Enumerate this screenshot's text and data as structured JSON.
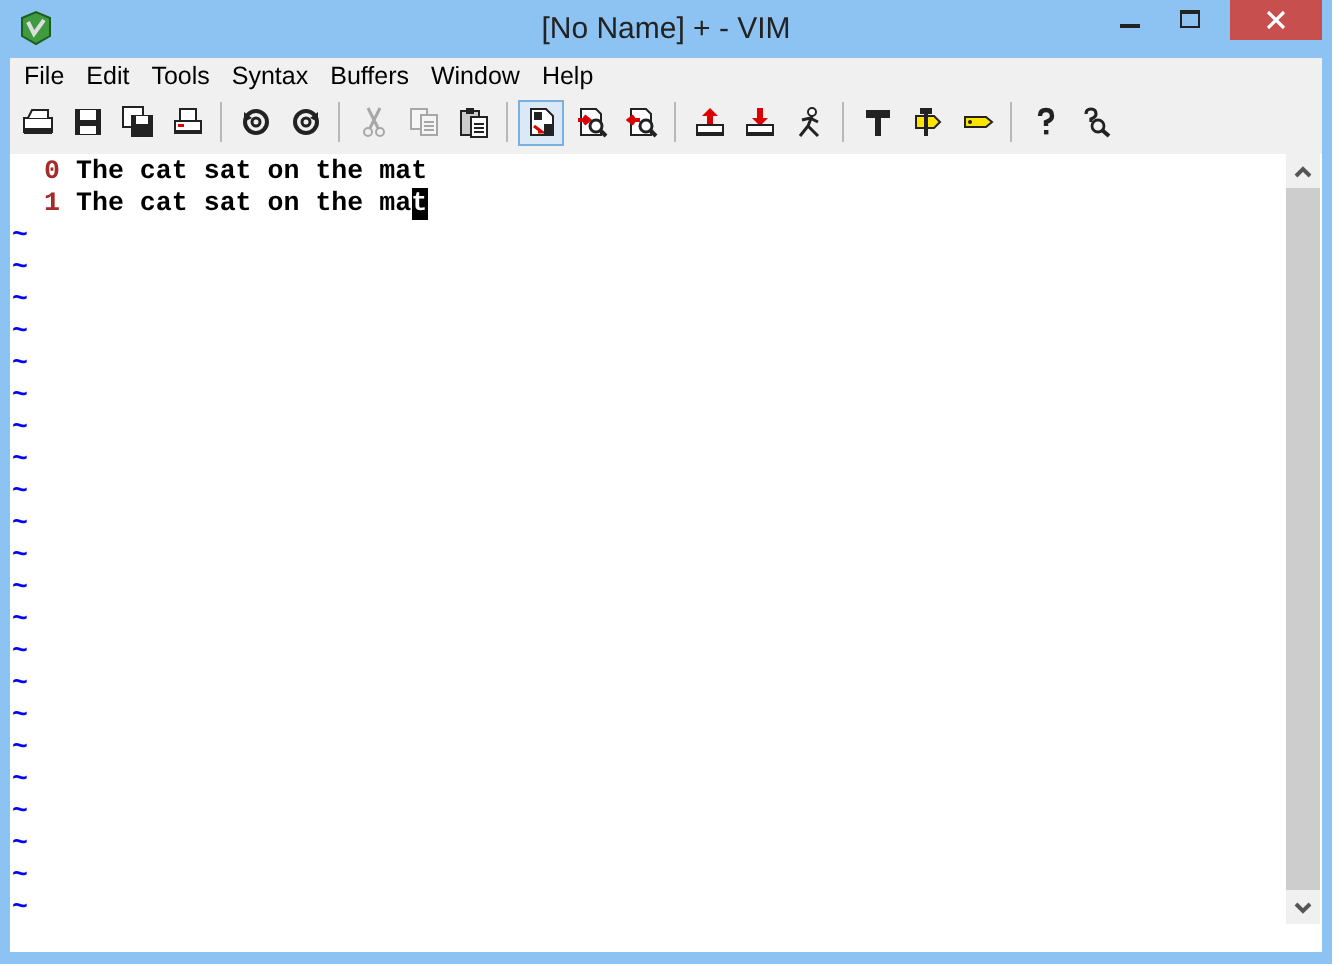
{
  "window": {
    "title": "[No Name] + - VIM"
  },
  "menu": [
    "File",
    "Edit",
    "Tools",
    "Syntax",
    "Buffers",
    "Window",
    "Help"
  ],
  "toolbar": [
    {
      "kind": "open",
      "disabled": false,
      "pressed": false
    },
    {
      "kind": "save",
      "disabled": false,
      "pressed": false
    },
    {
      "kind": "saveall",
      "disabled": false,
      "pressed": false
    },
    {
      "kind": "print",
      "disabled": false,
      "pressed": false
    },
    {
      "kind": "separator"
    },
    {
      "kind": "undo",
      "disabled": false,
      "pressed": false
    },
    {
      "kind": "redo",
      "disabled": false,
      "pressed": false
    },
    {
      "kind": "separator"
    },
    {
      "kind": "cut",
      "disabled": true,
      "pressed": false
    },
    {
      "kind": "copy",
      "disabled": true,
      "pressed": false
    },
    {
      "kind": "paste",
      "disabled": false,
      "pressed": false
    },
    {
      "kind": "separator"
    },
    {
      "kind": "replace",
      "disabled": false,
      "pressed": true
    },
    {
      "kind": "findnext",
      "disabled": false,
      "pressed": false
    },
    {
      "kind": "findprev",
      "disabled": false,
      "pressed": false
    },
    {
      "kind": "separator"
    },
    {
      "kind": "loadsession",
      "disabled": false,
      "pressed": false
    },
    {
      "kind": "savesession",
      "disabled": false,
      "pressed": false
    },
    {
      "kind": "runscript",
      "disabled": false,
      "pressed": false
    },
    {
      "kind": "separator"
    },
    {
      "kind": "make",
      "disabled": false,
      "pressed": false
    },
    {
      "kind": "tags",
      "disabled": false,
      "pressed": false
    },
    {
      "kind": "tagjump",
      "disabled": false,
      "pressed": false
    },
    {
      "kind": "separator"
    },
    {
      "kind": "help",
      "disabled": false,
      "pressed": false
    },
    {
      "kind": "findhelp",
      "disabled": false,
      "pressed": false
    }
  ],
  "lines": [
    {
      "number": "0",
      "text": "The cat sat on the mat"
    },
    {
      "number": "1",
      "text": "The cat sat on the ma",
      "cursor": "t"
    }
  ],
  "empty_lines": [
    "~",
    "~",
    "~",
    "~",
    "~",
    "~",
    "~",
    "~",
    "~",
    "~",
    "~",
    "~",
    "~",
    "~",
    "~",
    "~",
    "~",
    "~",
    "~",
    "~",
    "~",
    "~"
  ]
}
